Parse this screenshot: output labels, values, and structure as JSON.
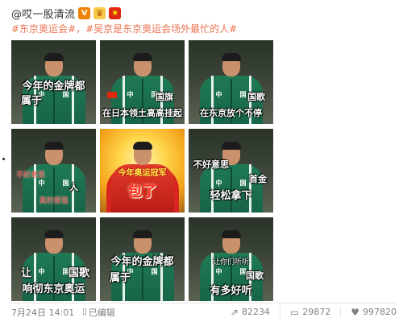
{
  "post": {
    "username": "@哎一股清流",
    "hashtags": "#东京奥运会#，#吴京是东京奥运会场外最忙的人#",
    "badges": {
      "verified_icon": "verified-v-icon",
      "crown_icon": "crown-icon",
      "flag_icon": "china-flag-icon"
    }
  },
  "grid": {
    "tiles": [
      {
        "lines": [
          "今年的金牌都",
          "属于"
        ],
        "chest": [
          "中",
          "国"
        ]
      },
      {
        "lines": [
          "国旗",
          "在日本领土高高挂起"
        ],
        "chest": [
          "中",
          "国"
        ]
      },
      {
        "lines": [
          "国歌",
          "在东京放个不停"
        ],
        "chest": [
          "中",
          "国"
        ]
      },
      {
        "lines": [
          "不好意思",
          "人",
          "真的很强"
        ],
        "chest": [
          "中",
          "国"
        ]
      },
      {
        "lines": [
          "今年奥运冠军",
          "包了"
        ],
        "chest": []
      },
      {
        "lines": [
          "不好意思",
          "首金",
          "轻松拿下"
        ],
        "chest": [
          "中",
          "国"
        ]
      },
      {
        "lines": [
          "让",
          "国歌",
          "响彻东京奥运"
        ],
        "chest": [
          "中",
          "国"
        ]
      },
      {
        "lines": [
          "今年的金牌都",
          "属于"
        ],
        "chest": [
          "中",
          "国"
        ]
      },
      {
        "lines": [
          "让你们听听",
          "国歌",
          "有多好听"
        ],
        "chest": [
          "中",
          "国"
        ]
      }
    ]
  },
  "footer": {
    "timestamp": "7月24日 14:01",
    "edited": "已编辑",
    "edited_icon": "edit-icon",
    "repost_count": "82234",
    "repost_icon": "repost-icon",
    "comment_count": "29872",
    "comment_icon": "comment-icon",
    "like_count": "997820",
    "like_icon": "thumbs-up-icon"
  },
  "colors": {
    "hashtag": "#eb7350",
    "jacket_green": "#1f7a55",
    "caption_red": "#e0302a",
    "muted_text": "#808080"
  }
}
